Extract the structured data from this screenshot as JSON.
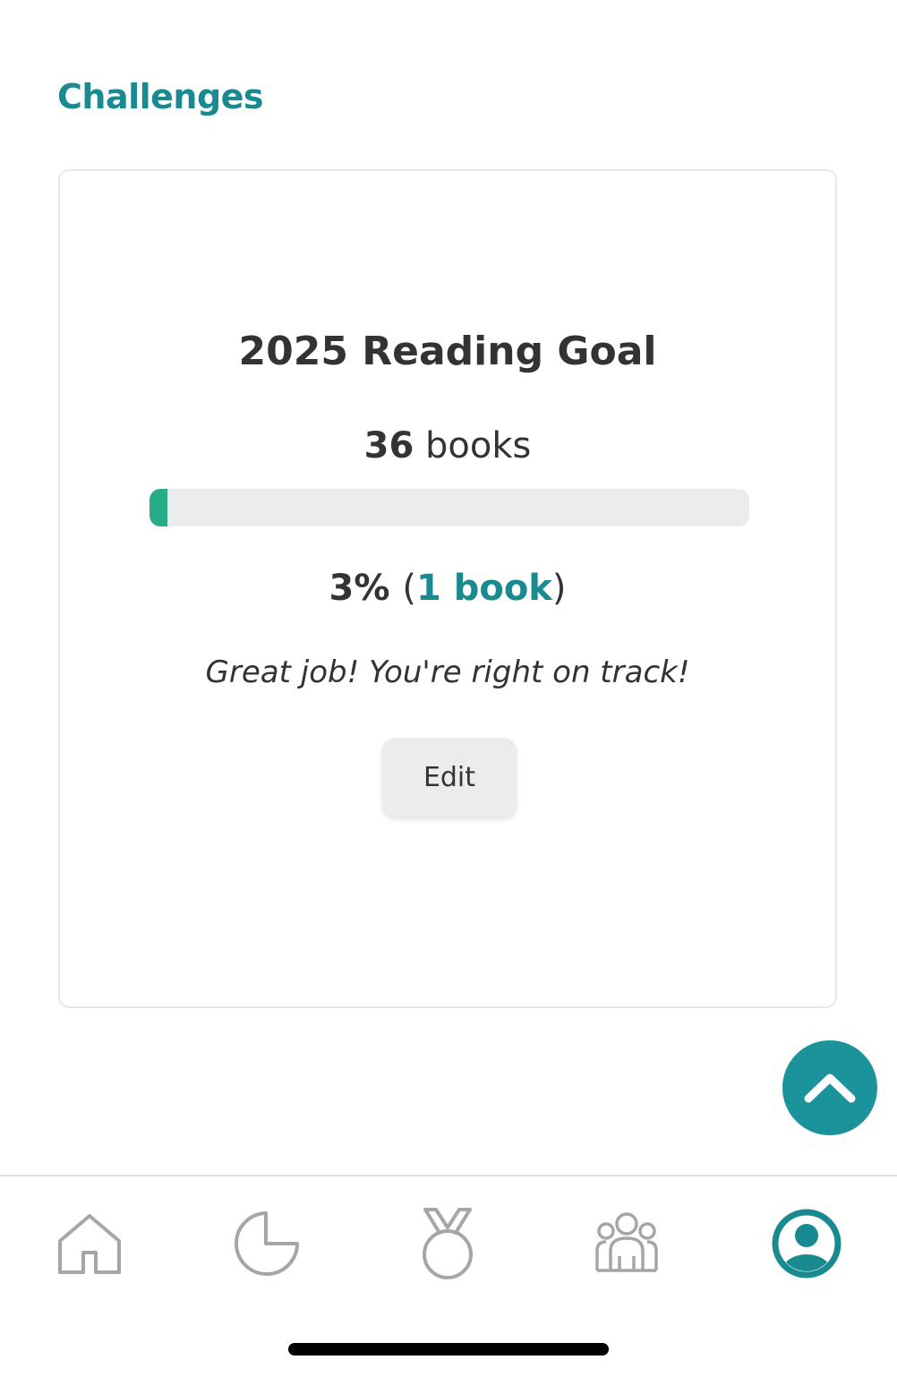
{
  "page": {
    "section_title": "Challenges"
  },
  "goal": {
    "title": "2025 Reading Goal",
    "target_count": "36",
    "target_unit": "books",
    "progress_fraction": 0.03,
    "percent_text": "3%",
    "paren_open": "(",
    "paren_close": ")",
    "books_read_text": "1 book",
    "message": "Great job! You're right on track!",
    "edit_label": "Edit"
  },
  "colors": {
    "accent": "#1a8a91",
    "progress_fill": "#27ad85",
    "progress_track": "#ececec",
    "inactive_icon": "#a6a6a6"
  },
  "scroll_button": {
    "icon": "chevron-up-icon"
  },
  "tab_bar": {
    "tabs": [
      {
        "icon": "home-icon",
        "active": false
      },
      {
        "icon": "pie-chart-icon",
        "active": false
      },
      {
        "icon": "medal-icon",
        "active": false
      },
      {
        "icon": "group-icon",
        "active": false
      },
      {
        "icon": "profile-icon",
        "active": true
      }
    ]
  }
}
